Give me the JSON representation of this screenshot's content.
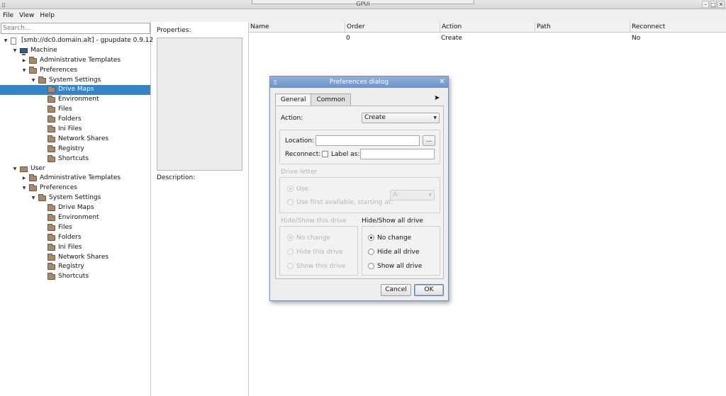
{
  "window": {
    "title": "GPUI"
  },
  "menu": {
    "file": "File",
    "view": "View",
    "help": "Help"
  },
  "search": {
    "placeholder": "Search..."
  },
  "tree": [
    {
      "label": "[smb://dc0.domain.alt] - gpupdate 0.9.12",
      "icon": "document-icon",
      "depth": 0,
      "arrow": "▼"
    },
    {
      "label": "Machine",
      "icon": "computer-icon",
      "depth": 1,
      "arrow": "▼"
    },
    {
      "label": "Administrative Templates",
      "icon": "folder-icon",
      "depth": 2,
      "arrow": "▶"
    },
    {
      "label": "Preferences",
      "icon": "folder-icon",
      "depth": 2,
      "arrow": "▼"
    },
    {
      "label": "System Settings",
      "icon": "folder-icon",
      "depth": 3,
      "arrow": "▼"
    },
    {
      "label": "Drive Maps",
      "icon": "folder-icon",
      "depth": 4,
      "arrow": "",
      "selected": true
    },
    {
      "label": "Environment",
      "icon": "folder-icon",
      "depth": 4,
      "arrow": ""
    },
    {
      "label": "Files",
      "icon": "folder-icon",
      "depth": 4,
      "arrow": ""
    },
    {
      "label": "Folders",
      "icon": "folder-icon",
      "depth": 4,
      "arrow": ""
    },
    {
      "label": "Ini Files",
      "icon": "folder-icon",
      "depth": 4,
      "arrow": ""
    },
    {
      "label": "Network Shares",
      "icon": "folder-icon",
      "depth": 4,
      "arrow": ""
    },
    {
      "label": "Registry",
      "icon": "folder-icon",
      "depth": 4,
      "arrow": ""
    },
    {
      "label": "Shortcuts",
      "icon": "folder-icon",
      "depth": 4,
      "arrow": ""
    },
    {
      "label": "User",
      "icon": "user-icon",
      "depth": 1,
      "arrow": "▼"
    },
    {
      "label": "Administrative Templates",
      "icon": "folder-icon",
      "depth": 2,
      "arrow": "▶"
    },
    {
      "label": "Preferences",
      "icon": "folder-icon",
      "depth": 2,
      "arrow": "▼"
    },
    {
      "label": "System Settings",
      "icon": "folder-icon",
      "depth": 3,
      "arrow": "▼"
    },
    {
      "label": "Drive Maps",
      "icon": "folder-icon",
      "depth": 4,
      "arrow": ""
    },
    {
      "label": "Environment",
      "icon": "folder-icon",
      "depth": 4,
      "arrow": ""
    },
    {
      "label": "Files",
      "icon": "folder-icon",
      "depth": 4,
      "arrow": ""
    },
    {
      "label": "Folders",
      "icon": "folder-icon",
      "depth": 4,
      "arrow": ""
    },
    {
      "label": "Ini Files",
      "icon": "folder-icon",
      "depth": 4,
      "arrow": ""
    },
    {
      "label": "Network Shares",
      "icon": "folder-icon",
      "depth": 4,
      "arrow": ""
    },
    {
      "label": "Registry",
      "icon": "folder-icon",
      "depth": 4,
      "arrow": ""
    },
    {
      "label": "Shortcuts",
      "icon": "folder-icon",
      "depth": 4,
      "arrow": ""
    }
  ],
  "properties": {
    "label": "Properties:",
    "description_label": "Description:"
  },
  "table": {
    "columns": [
      "Name",
      "Order",
      "Action",
      "Path",
      "Reconnect"
    ],
    "rows": [
      {
        "name": "",
        "order": "0",
        "action": "Create",
        "path": "",
        "reconnect": "No"
      }
    ]
  },
  "dialog": {
    "title": "Preferences dialog",
    "tabs": [
      "General",
      "Common"
    ],
    "active_tab": "General",
    "action_label": "Action:",
    "action_value": "Create",
    "location_label": "Location:",
    "location_value": "",
    "browse_label": "...",
    "reconnect_label": "Reconnect:",
    "reconnect_checked": false,
    "label_as_label": "Label as:",
    "label_as_value": "",
    "drive_letter_title": "Drive letter",
    "use_label": "Use:",
    "use_value": "A:",
    "use_first_label": "Use first available, starting at:",
    "hide_show_drive_title": "Hide/Show this drive",
    "hide_show_drive_options": [
      "No change",
      "Hide this drive",
      "Show this drive"
    ],
    "hide_show_all_title": "Hide/Show all drive",
    "hide_show_all_options": [
      "No change",
      "Hide all drive",
      "Show all drive"
    ],
    "cancel_label": "Cancel",
    "ok_label": "OK"
  },
  "colors": {
    "selection": "#3584c6",
    "dialog_title": "#7a9ed1"
  }
}
